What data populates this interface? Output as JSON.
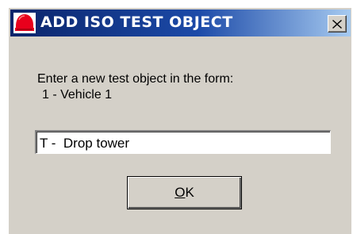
{
  "window": {
    "title": "ADD ISO TEST OBJECT",
    "icon": "helmet-icon",
    "close_icon": "close-icon"
  },
  "message": {
    "line1": "Enter a new test object in the form:",
    "line2": "1 - Vehicle 1"
  },
  "input": {
    "value": "T -  Drop tower"
  },
  "ok_button": {
    "mnemonic": "O",
    "rest": "K"
  },
  "colors": {
    "title_bar_start": "#0a246a",
    "title_bar_end": "#a6caf0",
    "dialog_background": "#d4d0c8",
    "icon_red": "#e8001c"
  }
}
